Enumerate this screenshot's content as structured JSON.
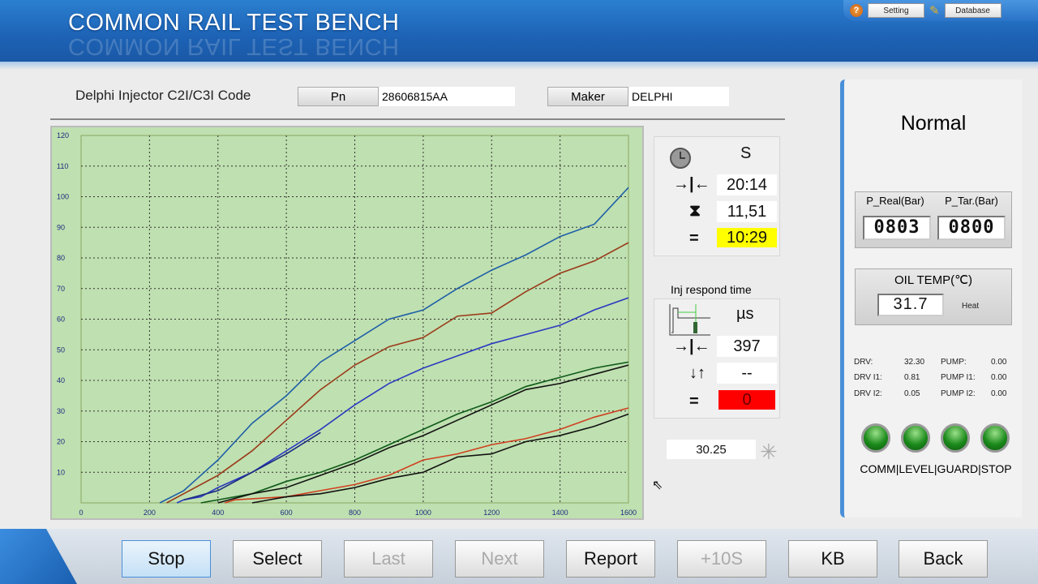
{
  "header": {
    "title": "COMMON RAIL TEST BENCH",
    "setting": "Setting",
    "database": "Database"
  },
  "info": {
    "code_label": "Delphi Injector C2I/C3I Code",
    "pn_label": "Pn",
    "pn_value": "28606815AA",
    "maker_label": "Maker",
    "maker_value": "DELPHI"
  },
  "timer": {
    "unit": "S",
    "interval": "20:14",
    "hourglass": "11,51",
    "equal": "10:29"
  },
  "respond": {
    "title": "Inj respond time",
    "unit": "µs",
    "interval": "397",
    "delta": "--",
    "equal": "0"
  },
  "misc_value": "30.25",
  "status": {
    "state": "Normal",
    "p_real_label": "P_Real(Bar)",
    "p_tar_label": "P_Tar.(Bar)",
    "p_real": "0803",
    "p_tar": "0800",
    "oil_label": "OIL TEMP(℃)",
    "oil_value": "31.7",
    "heat": "Heat"
  },
  "readings": [
    {
      "label": "DRV:",
      "value": "32.30"
    },
    {
      "label": "DRV I1:",
      "value": "0.81"
    },
    {
      "label": "DRV I2:",
      "value": "0.05"
    },
    {
      "label": "PUMP:",
      "value": "0.00"
    },
    {
      "label": "PUMP I1:",
      "value": "0.00"
    },
    {
      "label": "PUMP I2:",
      "value": "0.00"
    }
  ],
  "indicators_label": "COMM|LEVEL|GUARD|STOP",
  "buttons": [
    {
      "label": "Stop",
      "enabled": true
    },
    {
      "label": "Select",
      "enabled": true
    },
    {
      "label": "Last",
      "enabled": false
    },
    {
      "label": "Next",
      "enabled": false
    },
    {
      "label": "Report",
      "enabled": true
    },
    {
      "label": "+10S",
      "enabled": false
    },
    {
      "label": "KB",
      "enabled": true
    },
    {
      "label": "Back",
      "enabled": true
    }
  ],
  "colors": {
    "plot_bg": "#bfe0b0",
    "highlight_yellow": "#ffff00",
    "alarm_red": "#ff0000",
    "led_green": "#1b8a1b"
  },
  "chart_data": {
    "type": "line",
    "xlim": [
      0,
      1600
    ],
    "ylim": [
      0,
      120
    ],
    "grid": true,
    "xticks": [
      0,
      200,
      400,
      600,
      800,
      1000,
      1200,
      1400,
      1600
    ],
    "yticks": [
      10,
      20,
      30,
      40,
      50,
      60,
      70,
      80,
      90,
      100,
      110,
      120
    ],
    "series": [
      {
        "color": "#1f5fa8",
        "points": [
          [
            230,
            0
          ],
          [
            300,
            4
          ],
          [
            330,
            7
          ],
          [
            400,
            14
          ],
          [
            500,
            26
          ],
          [
            600,
            35
          ],
          [
            700,
            46
          ],
          [
            800,
            53
          ],
          [
            900,
            60
          ],
          [
            1000,
            63
          ],
          [
            1100,
            70
          ],
          [
            1200,
            76
          ],
          [
            1300,
            81
          ],
          [
            1400,
            87
          ],
          [
            1500,
            91
          ],
          [
            1600,
            103
          ]
        ]
      },
      {
        "color": "#9a3a1a",
        "points": [
          [
            250,
            0
          ],
          [
            300,
            3
          ],
          [
            400,
            9
          ],
          [
            500,
            17
          ],
          [
            600,
            27
          ],
          [
            700,
            37
          ],
          [
            800,
            45
          ],
          [
            900,
            51
          ],
          [
            1000,
            54
          ],
          [
            1100,
            61
          ],
          [
            1200,
            62
          ],
          [
            1300,
            69
          ],
          [
            1400,
            75
          ],
          [
            1500,
            79
          ],
          [
            1600,
            85
          ]
        ]
      },
      {
        "color": "#2a3ac0",
        "points": [
          [
            280,
            0
          ],
          [
            300,
            1
          ],
          [
            350,
            2
          ],
          [
            400,
            5
          ],
          [
            500,
            10
          ],
          [
            600,
            17
          ],
          [
            700,
            24
          ],
          [
            800,
            32
          ],
          [
            900,
            39
          ],
          [
            1000,
            44
          ],
          [
            1100,
            48
          ],
          [
            1200,
            52
          ],
          [
            1300,
            55
          ],
          [
            1400,
            58
          ],
          [
            1500,
            63
          ],
          [
            1600,
            67
          ]
        ]
      },
      {
        "color": "#1a2a80",
        "points": [
          [
            300,
            1
          ],
          [
            400,
            4
          ],
          [
            500,
            10
          ],
          [
            600,
            16
          ],
          [
            700,
            23
          ]
        ]
      },
      {
        "color": "#0f5a1a",
        "points": [
          [
            350,
            0
          ],
          [
            400,
            1
          ],
          [
            500,
            3
          ],
          [
            600,
            7
          ],
          [
            700,
            10
          ],
          [
            800,
            14
          ],
          [
            900,
            19
          ],
          [
            1000,
            24
          ],
          [
            1100,
            29
          ],
          [
            1200,
            33
          ],
          [
            1300,
            38
          ],
          [
            1400,
            41
          ],
          [
            1500,
            44
          ],
          [
            1600,
            46
          ]
        ]
      },
      {
        "color": "#111111",
        "points": [
          [
            400,
            0
          ],
          [
            500,
            3
          ],
          [
            600,
            5
          ],
          [
            700,
            9
          ],
          [
            800,
            13
          ],
          [
            900,
            18
          ],
          [
            1000,
            22
          ],
          [
            1100,
            27
          ],
          [
            1200,
            32
          ],
          [
            1300,
            37
          ],
          [
            1400,
            39
          ],
          [
            1500,
            42
          ],
          [
            1600,
            45
          ]
        ]
      },
      {
        "color": "#d04020",
        "points": [
          [
            420,
            0
          ],
          [
            450,
            1
          ],
          [
            600,
            2
          ],
          [
            700,
            4
          ],
          [
            800,
            6
          ],
          [
            900,
            9
          ],
          [
            1000,
            14
          ],
          [
            1100,
            16
          ],
          [
            1200,
            19
          ],
          [
            1300,
            21
          ],
          [
            1400,
            24
          ],
          [
            1500,
            28
          ],
          [
            1600,
            31
          ]
        ]
      },
      {
        "color": "#111111",
        "points": [
          [
            500,
            0
          ],
          [
            550,
            1
          ],
          [
            600,
            2
          ],
          [
            700,
            3
          ],
          [
            800,
            5
          ],
          [
            900,
            8
          ],
          [
            1000,
            10
          ],
          [
            1100,
            15
          ],
          [
            1200,
            16
          ],
          [
            1300,
            20
          ],
          [
            1400,
            22
          ],
          [
            1500,
            25
          ],
          [
            1600,
            29
          ]
        ]
      }
    ]
  }
}
